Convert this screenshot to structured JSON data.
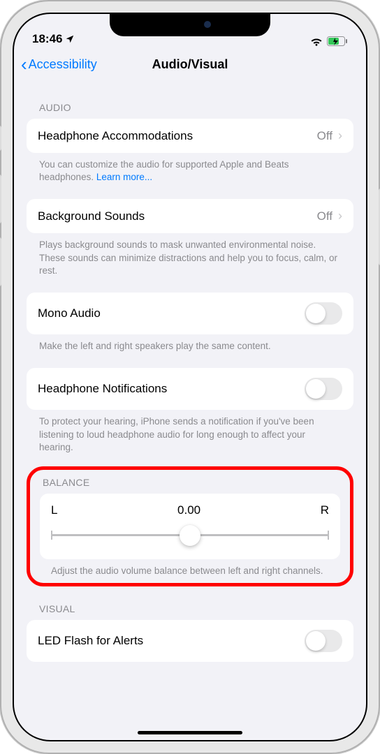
{
  "status": {
    "time": "18:46",
    "location_icon": "location-arrow",
    "wifi_icon": "wifi",
    "battery_icon": "battery-charging"
  },
  "nav": {
    "back_label": "Accessibility",
    "title": "Audio/Visual"
  },
  "sections": {
    "audio_header": "AUDIO",
    "balance_header": "BALANCE",
    "visual_header": "VISUAL"
  },
  "rows": {
    "headphone_accom": {
      "label": "Headphone Accommodations",
      "value": "Off"
    },
    "headphone_accom_footer": "You can customize the audio for supported Apple and Beats headphones. ",
    "learn_more": "Learn more...",
    "background_sounds": {
      "label": "Background Sounds",
      "value": "Off"
    },
    "background_sounds_footer": "Plays background sounds to mask unwanted environmental noise. These sounds can minimize distractions and help you to focus, calm, or rest.",
    "mono_audio": {
      "label": "Mono Audio"
    },
    "mono_audio_footer": "Make the left and right speakers play the same content.",
    "headphone_notif": {
      "label": "Headphone Notifications"
    },
    "headphone_notif_footer": "To protect your hearing, iPhone sends a notification if you've been listening to loud headphone audio for long enough to affect your hearing.",
    "balance": {
      "left": "L",
      "value": "0.00",
      "right": "R"
    },
    "balance_footer": "Adjust the audio volume balance between left and right channels.",
    "led_flash": {
      "label": "LED Flash for Alerts"
    }
  }
}
